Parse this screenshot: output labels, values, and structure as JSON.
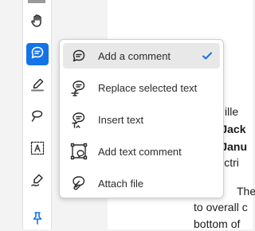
{
  "menu": {
    "items": [
      {
        "label": "Add a comment",
        "selected": true,
        "icon": "comment-icon"
      },
      {
        "label": "Replace selected text",
        "selected": false,
        "icon": "replace-text-icon"
      },
      {
        "label": "Insert text",
        "selected": false,
        "icon": "insert-text-icon"
      },
      {
        "label": "Add text comment",
        "selected": false,
        "icon": "text-comment-icon"
      },
      {
        "label": "Attach file",
        "selected": false,
        "icon": "attach-file-icon"
      }
    ]
  },
  "toolbar": {
    "tools": [
      "hand-icon",
      "comment-icon",
      "highlighter-icon",
      "draw-lasso-icon",
      "text-box-icon",
      "pen-sign-icon",
      "pin-icon"
    ],
    "active": "comment-icon",
    "accent": "#1473e6"
  },
  "document": {
    "lines": [
      "r. Pille",
      "a: Jack",
      "a: Janu",
      "Electri",
      "The",
      "to overall c",
      "bottom of"
    ]
  }
}
